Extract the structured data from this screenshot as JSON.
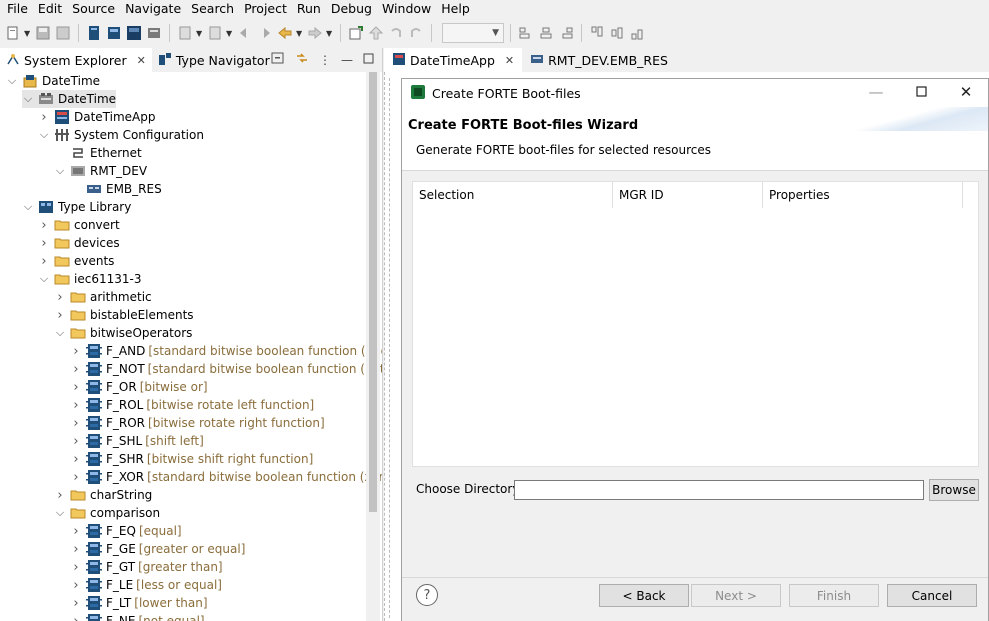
{
  "menu": [
    "File",
    "Edit",
    "Source",
    "Navigate",
    "Search",
    "Project",
    "Run",
    "Debug",
    "Window",
    "Help"
  ],
  "left_tabs": {
    "system_explorer": "System Explorer",
    "type_navigator": "Type Navigator"
  },
  "tree": [
    {
      "label": "DateTime",
      "desc": "",
      "level": 0,
      "twisty": "open",
      "icon": "project-icon"
    },
    {
      "label": "DateTime",
      "desc": "",
      "level": 1,
      "twisty": "open",
      "icon": "system-icon",
      "selected": true
    },
    {
      "label": "DateTimeApp",
      "desc": "",
      "level": 2,
      "twisty": "closed",
      "icon": "application-icon"
    },
    {
      "label": "System Configuration",
      "desc": "",
      "level": 2,
      "twisty": "open",
      "icon": "sysconf-icon"
    },
    {
      "label": "Ethernet",
      "desc": "",
      "level": 3,
      "twisty": "none",
      "icon": "segment-icon"
    },
    {
      "label": "RMT_DEV",
      "desc": "",
      "level": 3,
      "twisty": "open",
      "icon": "device-icon"
    },
    {
      "label": "EMB_RES",
      "desc": "",
      "level": 4,
      "twisty": "none",
      "icon": "resource-icon"
    },
    {
      "label": "Type Library",
      "desc": "",
      "level": 1,
      "twisty": "open",
      "icon": "typelib-icon"
    },
    {
      "label": "convert",
      "desc": "",
      "level": 2,
      "twisty": "closed",
      "icon": "folder-icon"
    },
    {
      "label": "devices",
      "desc": "",
      "level": 2,
      "twisty": "closed",
      "icon": "folder-icon"
    },
    {
      "label": "events",
      "desc": "",
      "level": 2,
      "twisty": "closed",
      "icon": "folder-icon"
    },
    {
      "label": "iec61131-3",
      "desc": "",
      "level": 2,
      "twisty": "open",
      "icon": "folder-icon"
    },
    {
      "label": "arithmetic",
      "desc": "",
      "level": 3,
      "twisty": "closed",
      "icon": "folder-icon"
    },
    {
      "label": "bistableElements",
      "desc": "",
      "level": 3,
      "twisty": "closed",
      "icon": "folder-icon"
    },
    {
      "label": "bitwiseOperators",
      "desc": "",
      "level": 3,
      "twisty": "open",
      "icon": "folder-icon"
    },
    {
      "label": "F_AND",
      "desc": "[standard bitwise boolean function (and)]",
      "level": 4,
      "twisty": "closed",
      "icon": "fb-icon"
    },
    {
      "label": "F_NOT",
      "desc": "[standard bitwise boolean function (not)]",
      "level": 4,
      "twisty": "closed",
      "icon": "fb-icon"
    },
    {
      "label": "F_OR",
      "desc": "[bitwise or]",
      "level": 4,
      "twisty": "closed",
      "icon": "fb-icon"
    },
    {
      "label": "F_ROL",
      "desc": "[bitwise rotate left function]",
      "level": 4,
      "twisty": "closed",
      "icon": "fb-icon"
    },
    {
      "label": "F_ROR",
      "desc": "[bitwise rotate right function]",
      "level": 4,
      "twisty": "closed",
      "icon": "fb-icon"
    },
    {
      "label": "F_SHL",
      "desc": "[shift left]",
      "level": 4,
      "twisty": "closed",
      "icon": "fb-icon"
    },
    {
      "label": "F_SHR",
      "desc": "[bitwise shift right function]",
      "level": 4,
      "twisty": "closed",
      "icon": "fb-icon"
    },
    {
      "label": "F_XOR",
      "desc": "[standard bitwise boolean function (xor)]",
      "level": 4,
      "twisty": "closed",
      "icon": "fb-icon"
    },
    {
      "label": "charString",
      "desc": "",
      "level": 3,
      "twisty": "closed",
      "icon": "folder-icon"
    },
    {
      "label": "comparison",
      "desc": "",
      "level": 3,
      "twisty": "open",
      "icon": "folder-icon"
    },
    {
      "label": "F_EQ",
      "desc": "[equal]",
      "level": 4,
      "twisty": "closed",
      "icon": "fb-icon"
    },
    {
      "label": "F_GE",
      "desc": "[greater or equal]",
      "level": 4,
      "twisty": "closed",
      "icon": "fb-icon"
    },
    {
      "label": "F_GT",
      "desc": "[greater than]",
      "level": 4,
      "twisty": "closed",
      "icon": "fb-icon"
    },
    {
      "label": "F_LE",
      "desc": "[less or equal]",
      "level": 4,
      "twisty": "closed",
      "icon": "fb-icon"
    },
    {
      "label": "F_LT",
      "desc": "[lower than]",
      "level": 4,
      "twisty": "closed",
      "icon": "fb-icon"
    },
    {
      "label": "F_NE",
      "desc": "[not equal]",
      "level": 4,
      "twisty": "closed",
      "icon": "fb-icon"
    }
  ],
  "editor_tabs": {
    "tab1": "DateTimeApp",
    "tab2": "RMT_DEV.EMB_RES"
  },
  "dialog": {
    "window_title": "Create FORTE Boot-files",
    "header_title": "Create FORTE Boot-files Wizard",
    "header_desc": "Generate FORTE boot-files for selected resources",
    "columns": [
      "Selection",
      "MGR ID",
      "Properties"
    ],
    "dir_label": "Choose Directory",
    "dir_value": "",
    "browse": "Browse",
    "back": "< Back",
    "next": "Next >",
    "finish": "Finish",
    "cancel": "Cancel",
    "help_glyph": "?"
  },
  "colors": {
    "desc_text": "#8a6d3b",
    "fb_icon": "#1f4e79",
    "folder": "#e8b84a"
  }
}
